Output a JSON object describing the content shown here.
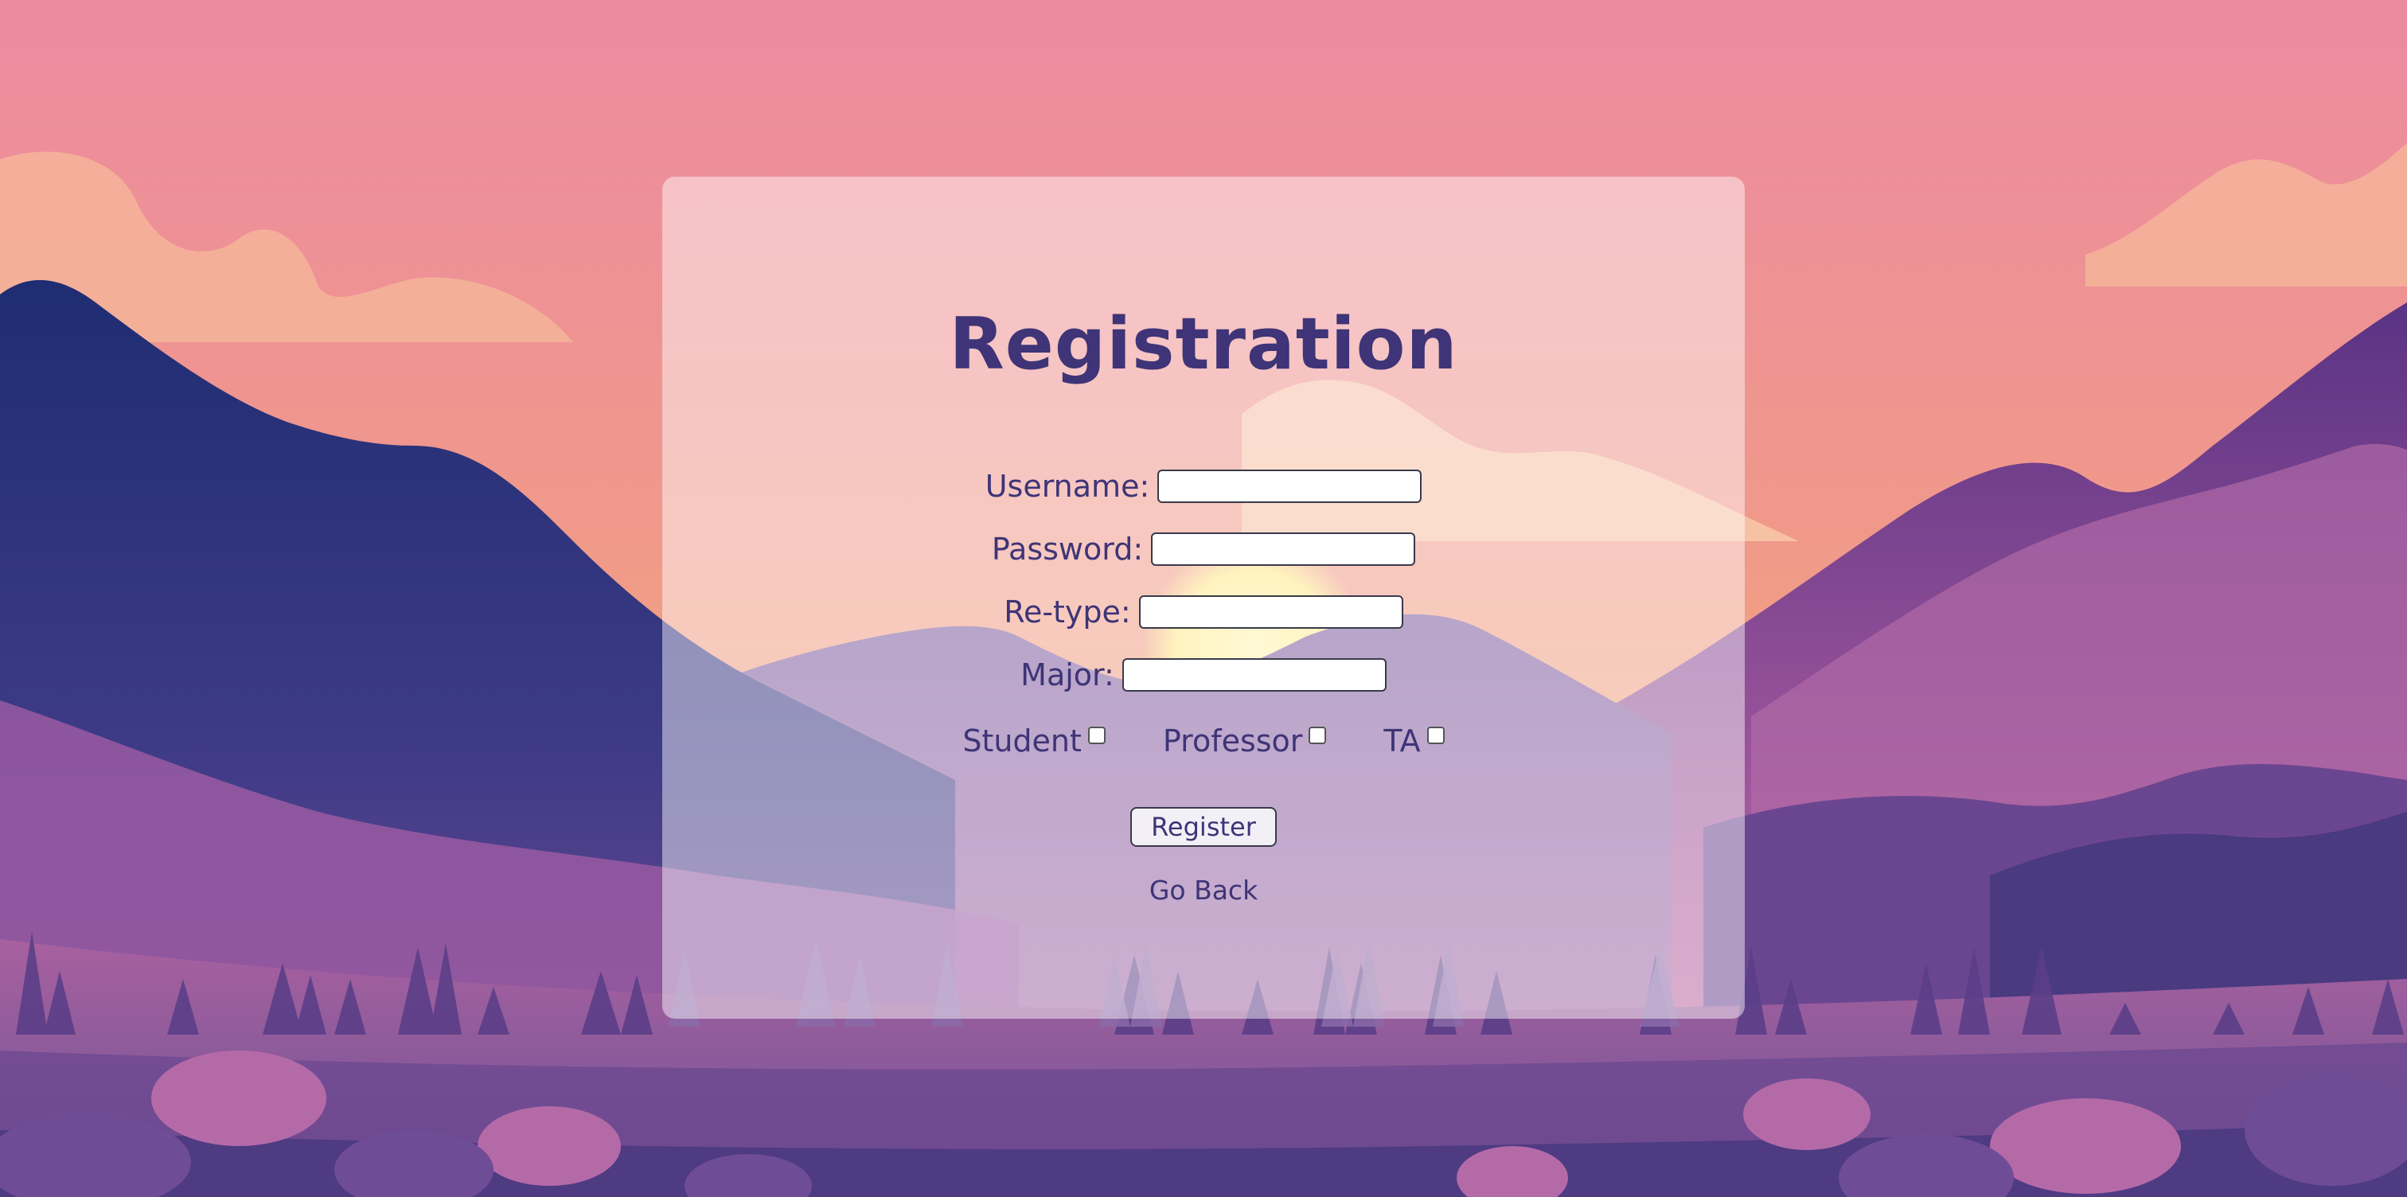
{
  "page": {
    "title": "Registration"
  },
  "form": {
    "fields": [
      {
        "label": "Username:",
        "value": ""
      },
      {
        "label": "Password:",
        "value": ""
      },
      {
        "label": "Re-type:",
        "value": ""
      },
      {
        "label": "Major:",
        "value": ""
      }
    ],
    "roles": [
      {
        "label": "Student",
        "checked": false
      },
      {
        "label": "Professor",
        "checked": false
      },
      {
        "label": "TA",
        "checked": false
      }
    ],
    "register_label": "Register",
    "go_back_label": "Go Back"
  },
  "colors": {
    "text": "#3e3477",
    "sky_top": "#ec8aa0",
    "sky_bottom": "#f2a97a",
    "mountain_dark": "#243072",
    "mountain_purple": "#8a4d96",
    "card_overlay": "rgba(255,255,255,0.46)"
  }
}
